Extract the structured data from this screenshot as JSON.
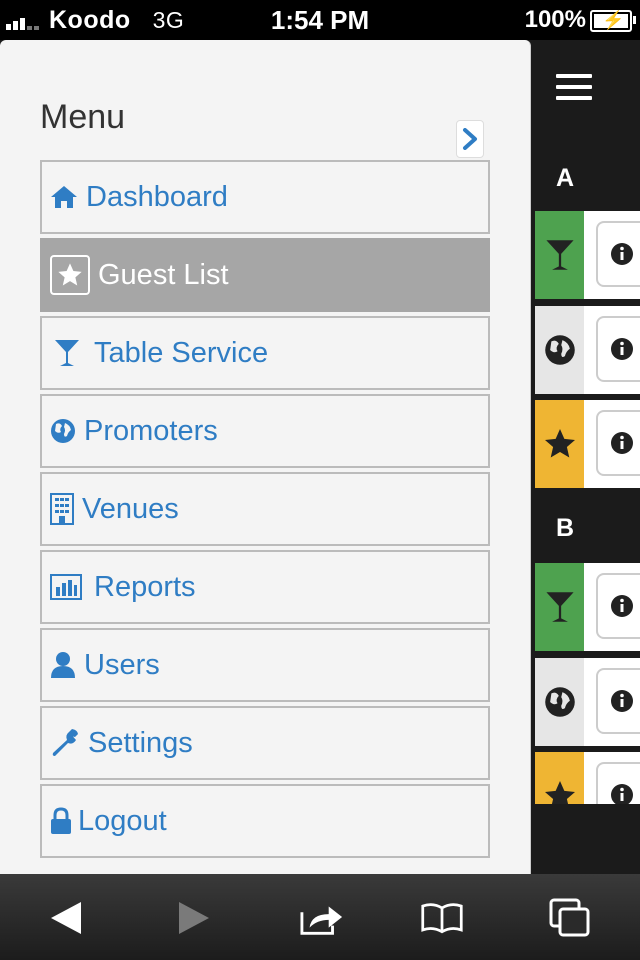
{
  "status_bar": {
    "carrier": "Koodo",
    "network": "3G",
    "time": "1:54 PM",
    "battery": "100%"
  },
  "menu": {
    "title": "Menu",
    "items": [
      {
        "label": "Dashboard",
        "icon": "home-icon",
        "active": false
      },
      {
        "label": "Guest List",
        "icon": "star-icon",
        "active": true
      },
      {
        "label": "Table Service",
        "icon": "cocktail-icon",
        "active": false
      },
      {
        "label": "Promoters",
        "icon": "globe-icon",
        "active": false
      },
      {
        "label": "Venues",
        "icon": "building-icon",
        "active": false
      },
      {
        "label": "Reports",
        "icon": "bar-chart-icon",
        "active": false
      },
      {
        "label": "Users",
        "icon": "user-icon",
        "active": false
      },
      {
        "label": "Settings",
        "icon": "wrench-icon",
        "active": false
      },
      {
        "label": "Logout",
        "icon": "lock-icon",
        "active": false
      }
    ]
  },
  "sections": [
    {
      "label": "A",
      "rows": [
        "cocktail-icon",
        "globe-icon",
        "star-icon"
      ]
    },
    {
      "label": "B",
      "rows": [
        "cocktail-icon",
        "globe-icon",
        "star-icon"
      ]
    }
  ],
  "colors": {
    "link_blue": "#2f7dc4",
    "active_grey": "#a6a6a6",
    "green": "#4ea24f",
    "yellow": "#efb533",
    "light_grey": "#e6e6e6"
  },
  "toolbar": {
    "buttons": [
      "back-icon",
      "forward-icon",
      "share-icon",
      "bookmarks-icon",
      "tabs-icon"
    ]
  }
}
